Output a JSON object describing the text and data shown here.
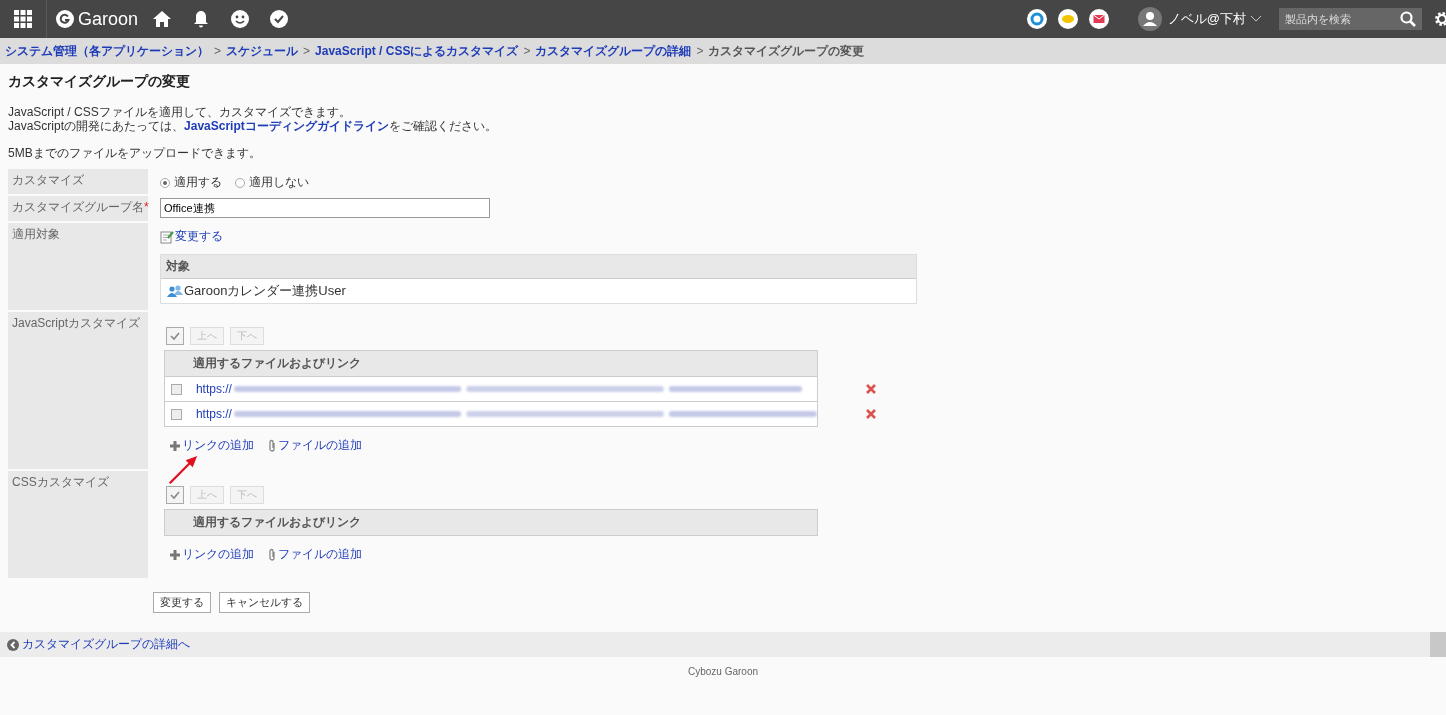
{
  "header": {
    "app_name": "Garoon",
    "user": "ノベル@下村",
    "search": {
      "placeholder": "製品内を検索"
    }
  },
  "breadcrumb_separator": ">",
  "breadcrumb": [
    {
      "label": "システム管理（各アプリケーション）",
      "link": true
    },
    {
      "label": "スケジュール",
      "link": true
    },
    {
      "label": "JavaScript / CSSによるカスタマイズ",
      "link": true
    },
    {
      "label": "カスタマイズグループの詳細",
      "link": true
    },
    {
      "label": "カスタマイズグループの変更",
      "link": false
    }
  ],
  "title": "カスタマイズグループの変更",
  "intro": "JavaScript / CSSファイルを適用して、カスタマイズできます。",
  "intro_link": "JavaScriptコーディングガイドライン",
  "intro_prefix": "JavaScriptの開発にあたっては、",
  "intro_suffix": "をご確認ください。",
  "upload_note": "5MBまでのファイルをアップロードできます。",
  "form": [
    {
      "kind": "radio",
      "label": "カスタマイズ",
      "options": [
        {
          "label": "適用する",
          "selected": true
        },
        {
          "label": "適用しない",
          "selected": false
        }
      ]
    },
    {
      "kind": "text",
      "label": "カスタマイズグループ名",
      "required_mark": "*",
      "value": "Office連携"
    },
    {
      "kind": "targets",
      "label": "適用対象",
      "change_link": "変更する",
      "column": "対象",
      "rows": [
        "Garoonカレンダー連携User"
      ]
    },
    {
      "kind": "files",
      "label": "JavaScriptカスタマイズ",
      "select_all_checked": true,
      "up": "上へ",
      "down": "下へ",
      "column": "適用するファイルおよびリンク",
      "files": [
        {
          "prefix": "https://",
          "checked": false
        },
        {
          "prefix": "https://",
          "checked": false
        }
      ],
      "add_link": "リンクの追加",
      "add_file": "ファイルの追加",
      "annotated": true
    },
    {
      "kind": "files",
      "label": "CSSカスタマイズ",
      "select_all_checked": true,
      "up": "上へ",
      "down": "下へ",
      "column": "適用するファイルおよびリンク",
      "add_link": "リンクの追加",
      "add_file": "ファイルの追加"
    }
  ],
  "buttons": [
    "変更する",
    "キャンセルする"
  ],
  "back_link": "カスタマイズグループの詳細へ",
  "footer": "Cybozu Garoon"
}
